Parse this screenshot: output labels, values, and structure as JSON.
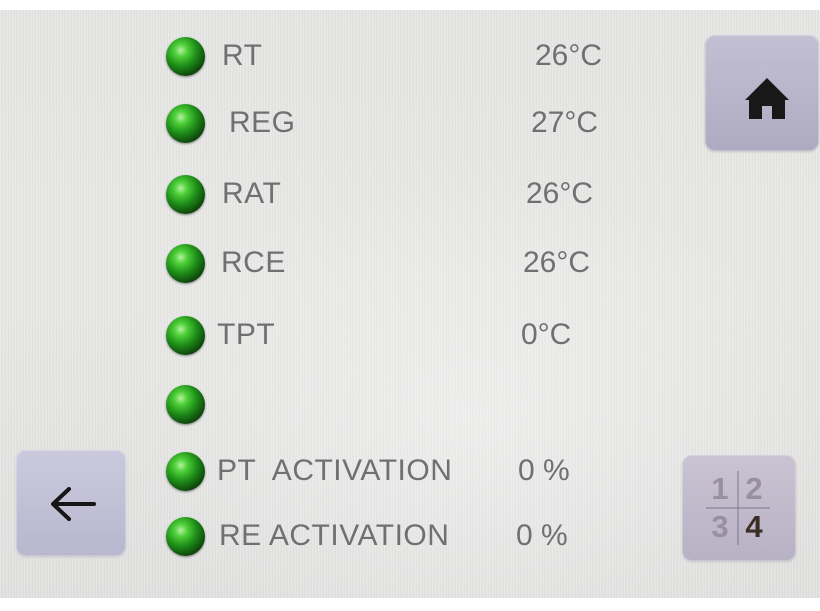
{
  "sensors": [
    {
      "label": "RT",
      "value": "26°C"
    },
    {
      "label": "REG",
      "value": "27°C"
    },
    {
      "label": "RAT",
      "value": "26°C"
    },
    {
      "label": "RCE",
      "value": "26°C"
    },
    {
      "label": "TPT",
      "value": "0°C"
    },
    {
      "label": "",
      "value": ""
    },
    {
      "label": "PT  ACTIVATION",
      "value": "0 %"
    },
    {
      "label": "RE ACTIVATION",
      "value": "0 %"
    }
  ],
  "page_indicator": {
    "cells": [
      "1",
      "2",
      "3",
      "4"
    ],
    "current": "4"
  },
  "icons": {
    "home": "home-icon",
    "back": "arrow-left-icon",
    "indicator": "status-led-icon"
  },
  "colors": {
    "led_green": "#2ea324",
    "button_background": "#b8b5cb",
    "text": "#707072",
    "page_inactive": "#9a8f9f",
    "page_current": "#3b2e27"
  }
}
